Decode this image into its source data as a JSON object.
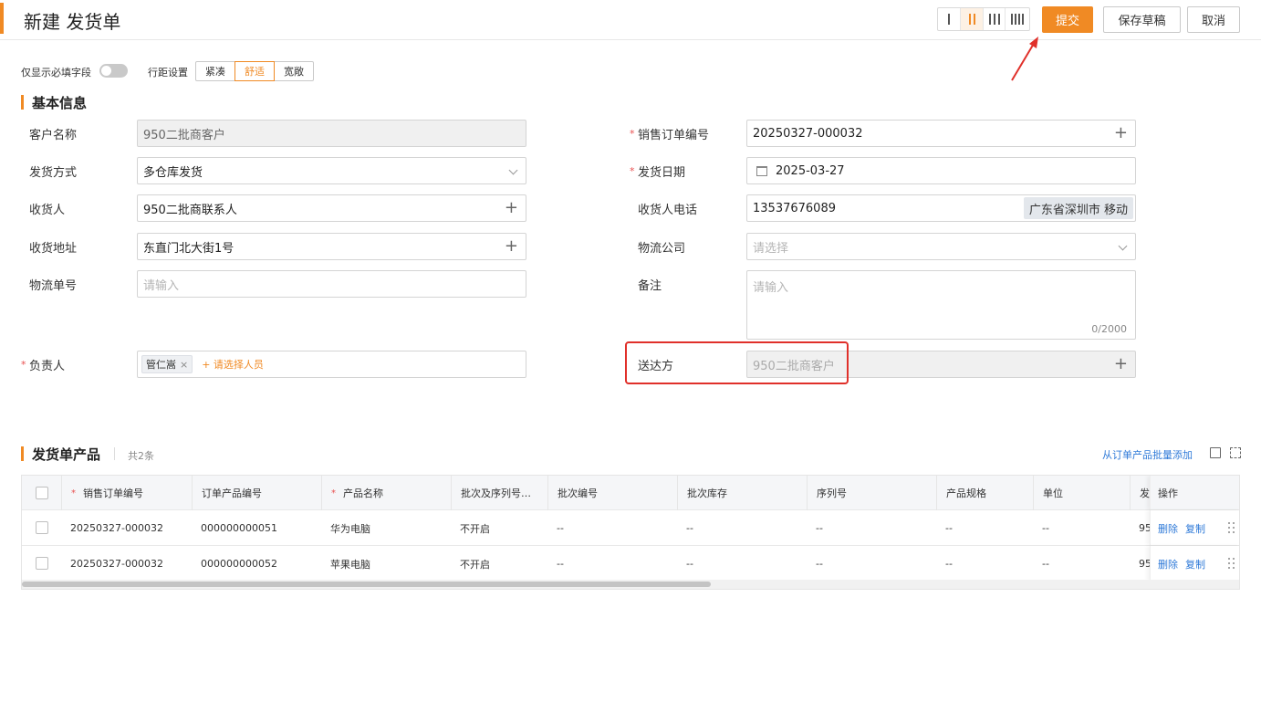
{
  "header": {
    "title": "新建 发货单",
    "column_options": [
      "1",
      "2",
      "3",
      "4"
    ],
    "active_columns": 2,
    "submit_label": "提交",
    "save_draft_label": "保存草稿",
    "cancel_label": "取消"
  },
  "toolbar": {
    "required_only_label": "仅显示必填字段",
    "required_only_on": false,
    "spacing_label": "行距设置",
    "spacing_options": [
      "紧凑",
      "舒适",
      "宽敞"
    ],
    "spacing_selected": "舒适"
  },
  "basic_info": {
    "title": "基本信息",
    "customer": {
      "label": "客户名称",
      "value": "950二批商客户"
    },
    "ship_method": {
      "label": "发货方式",
      "value": "多仓库发货"
    },
    "receiver": {
      "label": "收货人",
      "value": "950二批商联系人"
    },
    "address": {
      "label": "收货地址",
      "value": "东直门北大街1号"
    },
    "tracking_no": {
      "label": "物流单号",
      "placeholder": "请输入"
    },
    "owner": {
      "label": "负责人",
      "person": "管仁嵩",
      "add_label": "+ 请选择人员"
    },
    "sales_order_no": {
      "label": "销售订单编号",
      "value": "20250327-000032"
    },
    "ship_date": {
      "label": "发货日期",
      "value": "2025-03-27"
    },
    "receiver_phone": {
      "label": "收货人电话",
      "value": "13537676089",
      "location": "广东省深圳市 移动"
    },
    "logistics_company": {
      "label": "物流公司",
      "placeholder": "请选择"
    },
    "remark": {
      "label": "备注",
      "placeholder": "请输入",
      "counter": "0/2000"
    },
    "deliver_to": {
      "label": "送达方",
      "value": "950二批商客户"
    }
  },
  "products": {
    "title": "发货单产品",
    "count_text": "共2条",
    "batch_add_label": "从订单产品批量添加",
    "columns": [
      "销售订单编号",
      "订单产品编号",
      "产品名称",
      "批次及序列号…",
      "批次编号",
      "批次库存",
      "序列号",
      "产品规格",
      "单位",
      "发",
      "操作"
    ],
    "required_columns": [
      0,
      2
    ],
    "rows": [
      {
        "cells": [
          "20250327-000032",
          "000000000051",
          "华为电脑",
          "不开启",
          "--",
          "--",
          "--",
          "--",
          "--",
          "95"
        ],
        "delete": "删除",
        "copy": "复制"
      },
      {
        "cells": [
          "20250327-000032",
          "000000000052",
          "苹果电脑",
          "不开启",
          "--",
          "--",
          "--",
          "--",
          "--",
          "95"
        ],
        "delete": "删除",
        "copy": "复制"
      }
    ],
    "horizontal_scroll_fraction": 0.565
  },
  "colors": {
    "accent": "#f08a24",
    "link": "#2f7ad8",
    "required": "#e85050",
    "highlight": "#e0302a"
  }
}
